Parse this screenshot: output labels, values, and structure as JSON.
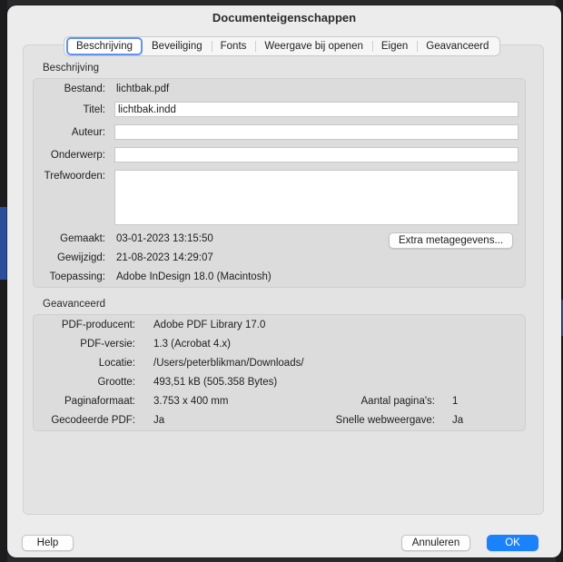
{
  "dialog": {
    "title": "Documenteigenschappen"
  },
  "tabs": [
    {
      "label": "Beschrijving",
      "active": true
    },
    {
      "label": "Beveiliging",
      "active": false
    },
    {
      "label": "Fonts",
      "active": false
    },
    {
      "label": "Weergave bij openen",
      "active": false
    },
    {
      "label": "Eigen",
      "active": false
    },
    {
      "label": "Geavanceerd",
      "active": false
    }
  ],
  "description": {
    "section_title": "Beschrijving",
    "file_label": "Bestand:",
    "file_value": "lichtbak.pdf",
    "title_label": "Titel:",
    "title_value": "lichtbak.indd",
    "author_label": "Auteur:",
    "author_value": "",
    "subject_label": "Onderwerp:",
    "subject_value": "",
    "keywords_label": "Trefwoorden:",
    "keywords_value": "",
    "created_label": "Gemaakt:",
    "created_value": "03-01-2023 13:15:50",
    "modified_label": "Gewijzigd:",
    "modified_value": "21-08-2023 14:29:07",
    "application_label": "Toepassing:",
    "application_value": "Adobe InDesign 18.0 (Macintosh)",
    "metadata_button": "Extra metagegevens..."
  },
  "advanced": {
    "section_title": "Geavanceerd",
    "producer_label": "PDF-producent:",
    "producer_value": "Adobe PDF Library 17.0",
    "version_label": "PDF-versie:",
    "version_value": "1.3 (Acrobat 4.x)",
    "location_label": "Locatie:",
    "location_value": "/Users/peterblikman/Downloads/",
    "size_label": "Grootte:",
    "size_value": "493,51 kB (505.358 Bytes)",
    "page_size_label": "Paginaformaat:",
    "page_size_value": "3.753 x 400 mm",
    "page_count_label": "Aantal pagina's:",
    "page_count_value": "1",
    "tagged_label": "Gecodeerde PDF:",
    "tagged_value": "Ja",
    "fast_web_label": "Snelle webweergave:",
    "fast_web_value": "Ja"
  },
  "footer": {
    "help": "Help",
    "cancel": "Annuleren",
    "ok": "OK"
  },
  "colors": {
    "accent": "#1a82fb",
    "tab_focus": "#5f93f3"
  }
}
